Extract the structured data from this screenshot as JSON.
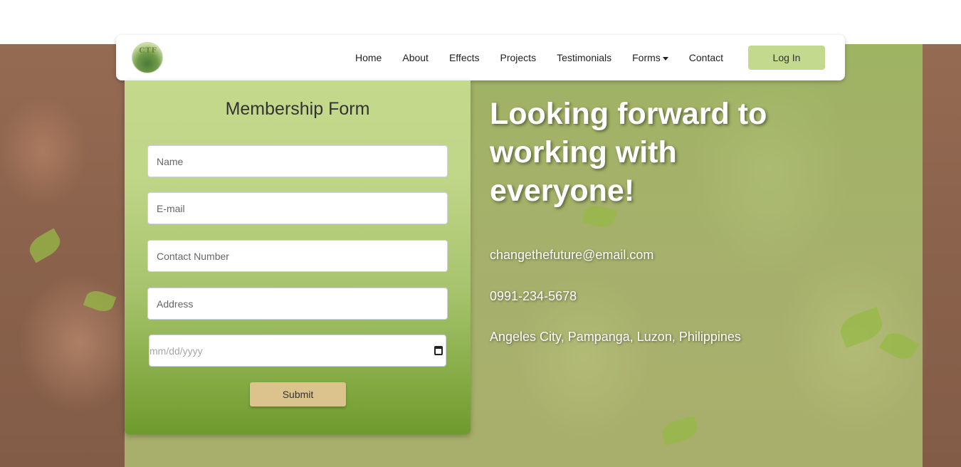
{
  "navbar": {
    "logo_text": "CTF",
    "links": [
      "Home",
      "About",
      "Effects",
      "Projects",
      "Testimonials",
      "Forms",
      "Contact"
    ],
    "login_label": "Log In"
  },
  "form": {
    "title": "Membership Form",
    "name_placeholder": "Name",
    "email_placeholder": "E-mail",
    "contact_placeholder": "Contact Number",
    "address_placeholder": "Address",
    "date_placeholder": "mm/dd/yyyy",
    "submit_label": "Submit"
  },
  "hero": {
    "headline": "Looking forward to working with everyone!",
    "email": "changethefuture@email.com",
    "phone": "0991-234-5678",
    "address": "Angeles City, Pampanga, Luzon, Philippines"
  },
  "colors": {
    "accent_green": "#c3d98e",
    "submit_tan": "#dcc28c",
    "form_top": "#c5d98c",
    "form_bottom": "#6f9a2d"
  },
  "icons": [
    "logo-icon",
    "chevron-down-icon",
    "calendar-icon"
  ]
}
